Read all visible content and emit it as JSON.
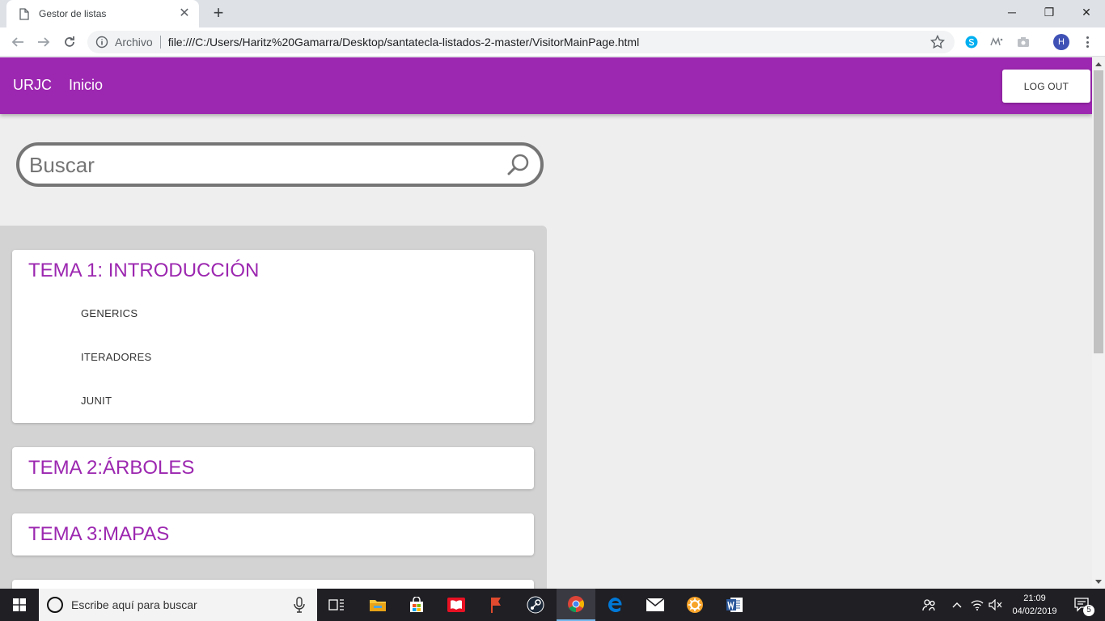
{
  "browser": {
    "tab_title": "Gestor de listas",
    "tab_close": "✕",
    "new_tab": "+",
    "scheme_label": "Archivo",
    "url": "file:///C:/Users/Haritz%20Gamarra/Desktop/santatecla-listados-2-master/VisitorMainPage.html",
    "profile_initial": "H",
    "window_controls": {
      "minimize": "─",
      "restore": "❐",
      "close": "✕"
    }
  },
  "icons": [
    "document-icon",
    "close-icon",
    "plus-icon",
    "back-icon",
    "forward-icon",
    "reload-icon",
    "info-icon",
    "star-icon",
    "skype-icon",
    "extension-icon",
    "camera-icon",
    "kebab-menu-icon",
    "search-icon",
    "windows-start-icon",
    "cortana-icon",
    "microphone-icon",
    "task-view-icon",
    "file-explorer-icon",
    "store-icon",
    "reader-icon",
    "flag-app-icon",
    "steam-icon",
    "chrome-icon",
    "edge-icon",
    "mail-icon",
    "settings-app-icon",
    "word-icon",
    "people-icon",
    "chevron-up-icon",
    "wifi-icon",
    "volume-muted-icon",
    "notifications-icon"
  ],
  "app": {
    "brand": "URJC",
    "nav_home": "Inicio",
    "logout_label": "LOG OUT",
    "accent_color": "#9c27b0"
  },
  "search": {
    "placeholder": "Buscar"
  },
  "topics": [
    {
      "title": "TEMA 1: INTRODUCCIÓN",
      "items": [
        "GENERICS",
        "ITERADORES",
        "JUNIT"
      ]
    },
    {
      "title": "TEMA 2:ÁRBOLES",
      "items": []
    },
    {
      "title": "TEMA 3:MAPAS",
      "items": []
    }
  ],
  "taskbar": {
    "search_placeholder": "Escribe aquí para buscar",
    "time": "21:09",
    "date": "04/02/2019",
    "notification_count": "5"
  }
}
